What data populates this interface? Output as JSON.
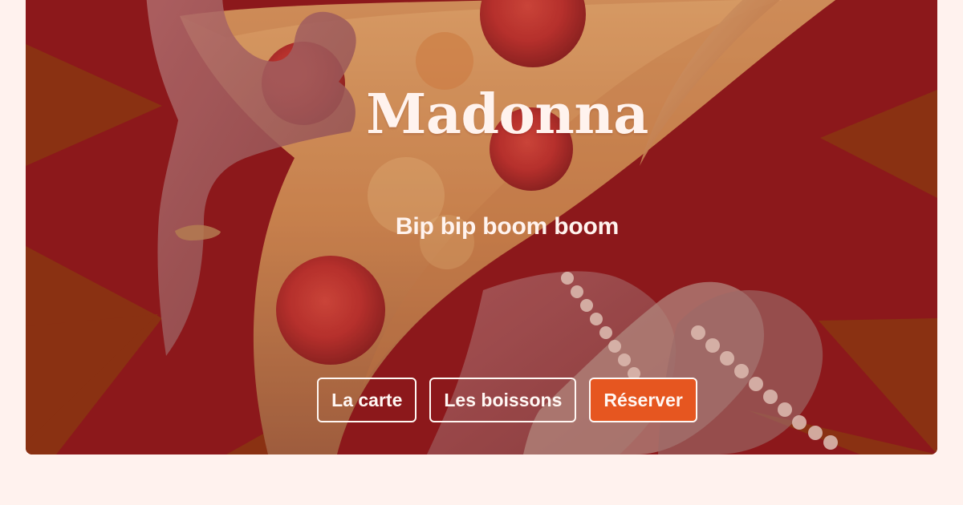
{
  "hero": {
    "title": "Madonna",
    "subtitle": "Bip bip boom boom",
    "image": "pizza-hand-photo"
  },
  "actions": [
    {
      "label": "La carte",
      "style": "outline"
    },
    {
      "label": "Les boissons",
      "style": "outline"
    },
    {
      "label": "Réserver",
      "style": "filled"
    }
  ],
  "colors": {
    "page_background": "#FFF2EE",
    "hero_background": "#8E1A1C",
    "starburst": "#8C3712",
    "text": "#FFF3EE",
    "accent": "#E65620"
  }
}
